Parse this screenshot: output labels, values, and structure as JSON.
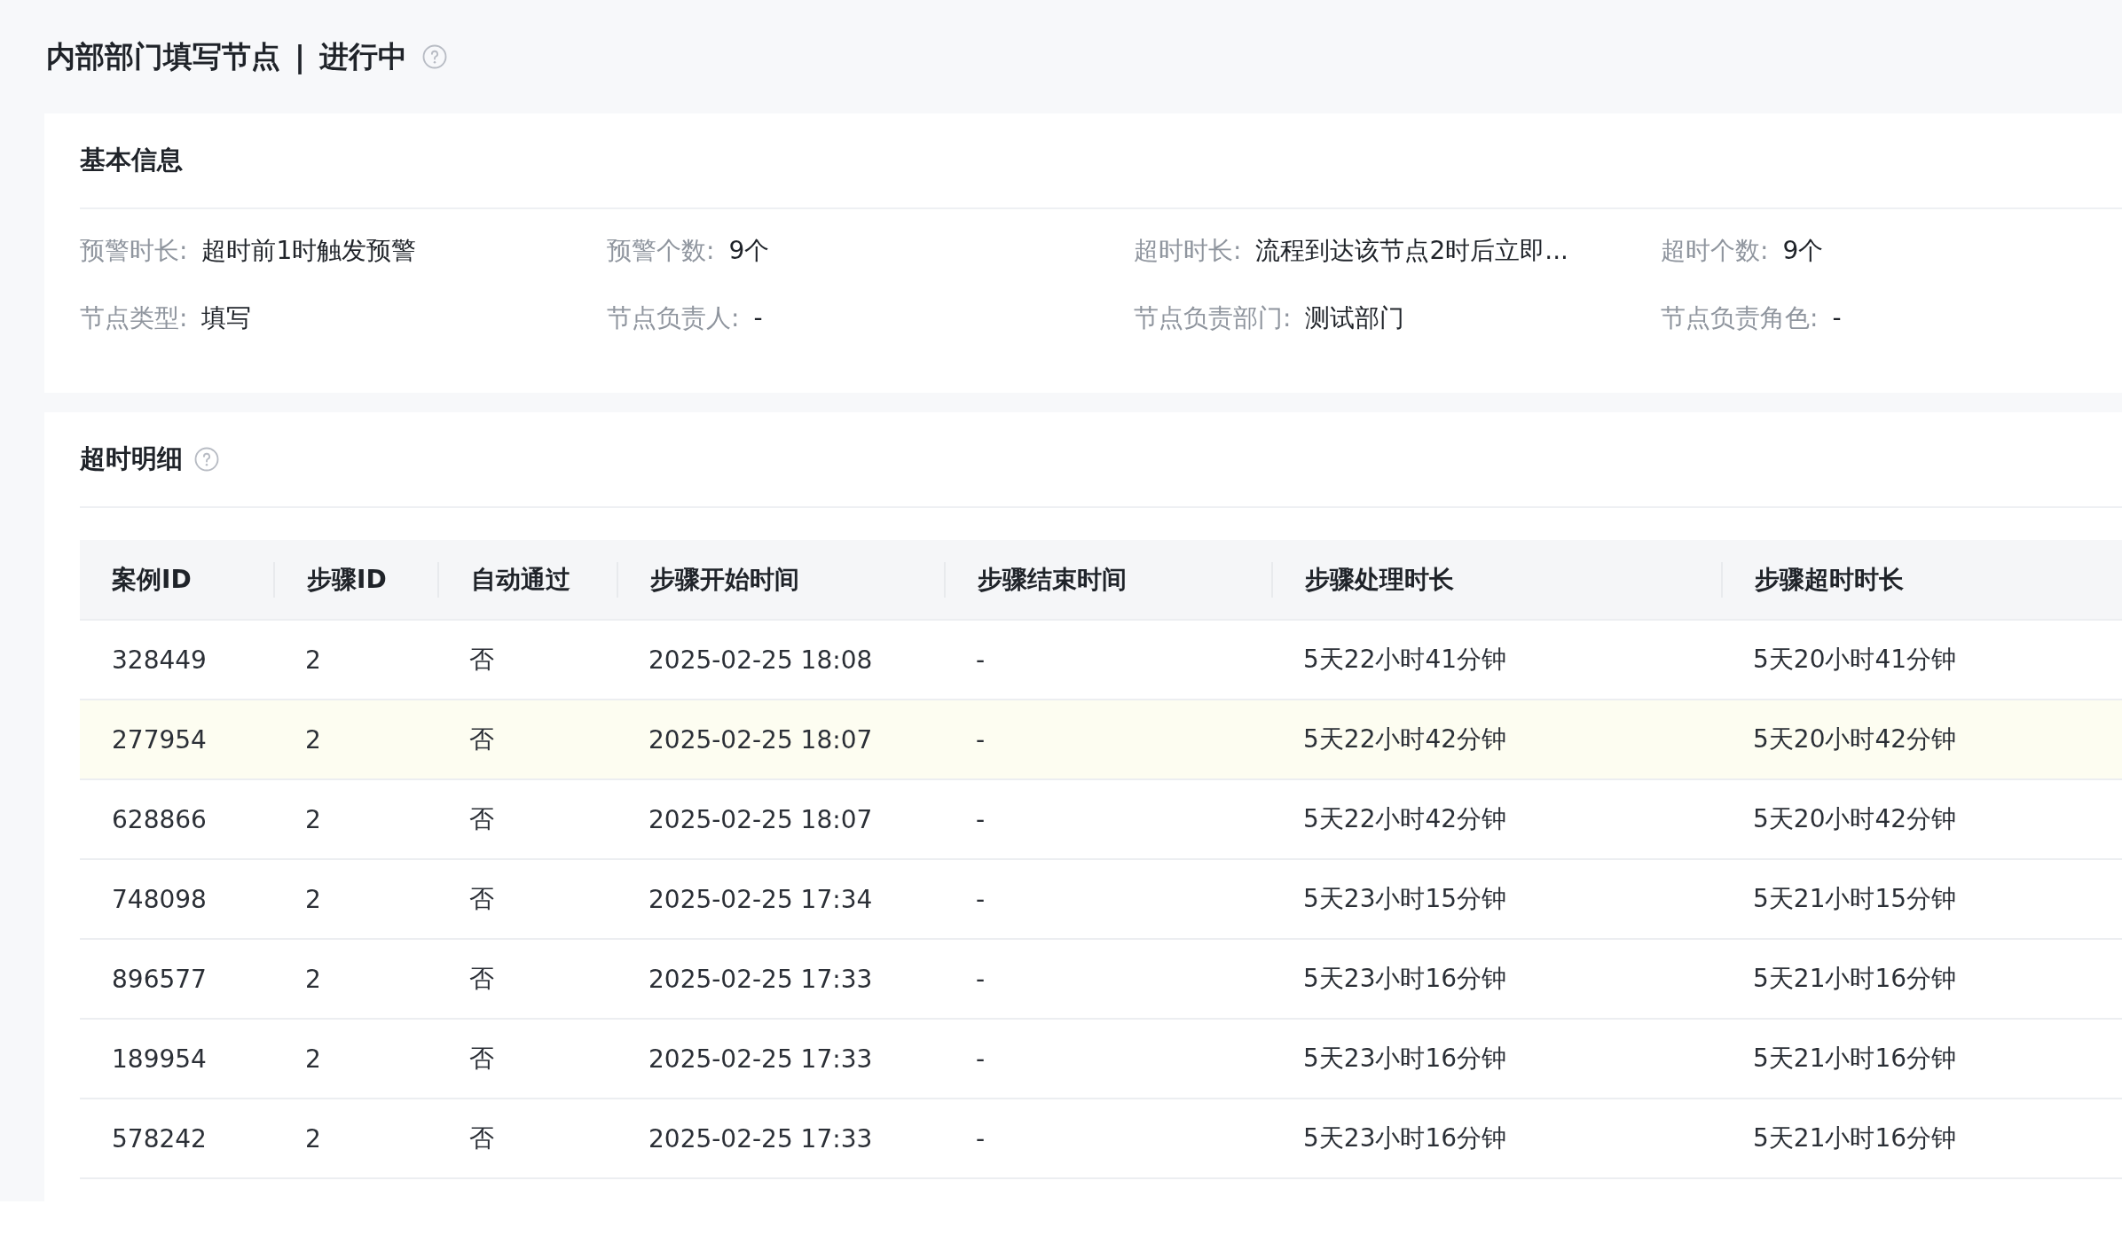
{
  "header": {
    "title": "内部部门填写节点",
    "separator": "|",
    "status": "进行中"
  },
  "basic_info": {
    "title": "基本信息",
    "fields": [
      {
        "label": "预警时长:",
        "value": "超时前1时触发预警"
      },
      {
        "label": "预警个数:",
        "value": "9个"
      },
      {
        "label": "超时时长:",
        "value": "流程到达该节点2时后立即..."
      },
      {
        "label": "超时个数:",
        "value": "9个"
      },
      {
        "label": "节点类型:",
        "value": "填写"
      },
      {
        "label": "节点负责人:",
        "value": "-"
      },
      {
        "label": "节点负责部门:",
        "value": "测试部门"
      },
      {
        "label": "节点负责角色:",
        "value": "-"
      }
    ]
  },
  "timeout_detail": {
    "title": "超时明细",
    "table": {
      "columns": [
        "案例ID",
        "步骤ID",
        "自动通过",
        "步骤开始时间",
        "步骤结束时间",
        "步骤处理时长",
        "步骤超时时长"
      ],
      "rows": [
        {
          "selected": false,
          "cells": [
            "328449",
            "2",
            "否",
            "2025-02-25 18:08",
            "-",
            "5天22小时41分钟",
            "5天20小时41分钟"
          ]
        },
        {
          "selected": true,
          "cells": [
            "277954",
            "2",
            "否",
            "2025-02-25 18:07",
            "-",
            "5天22小时42分钟",
            "5天20小时42分钟"
          ]
        },
        {
          "selected": false,
          "cells": [
            "628866",
            "2",
            "否",
            "2025-02-25 18:07",
            "-",
            "5天22小时42分钟",
            "5天20小时42分钟"
          ]
        },
        {
          "selected": false,
          "cells": [
            "748098",
            "2",
            "否",
            "2025-02-25 17:34",
            "-",
            "5天23小时15分钟",
            "5天21小时15分钟"
          ]
        },
        {
          "selected": false,
          "cells": [
            "896577",
            "2",
            "否",
            "2025-02-25 17:33",
            "-",
            "5天23小时16分钟",
            "5天21小时16分钟"
          ]
        },
        {
          "selected": false,
          "cells": [
            "189954",
            "2",
            "否",
            "2025-02-25 17:33",
            "-",
            "5天23小时16分钟",
            "5天21小时16分钟"
          ]
        },
        {
          "selected": false,
          "cells": [
            "578242",
            "2",
            "否",
            "2025-02-25 17:33",
            "-",
            "5天23小时16分钟",
            "5天21小时16分钟"
          ]
        }
      ]
    }
  }
}
